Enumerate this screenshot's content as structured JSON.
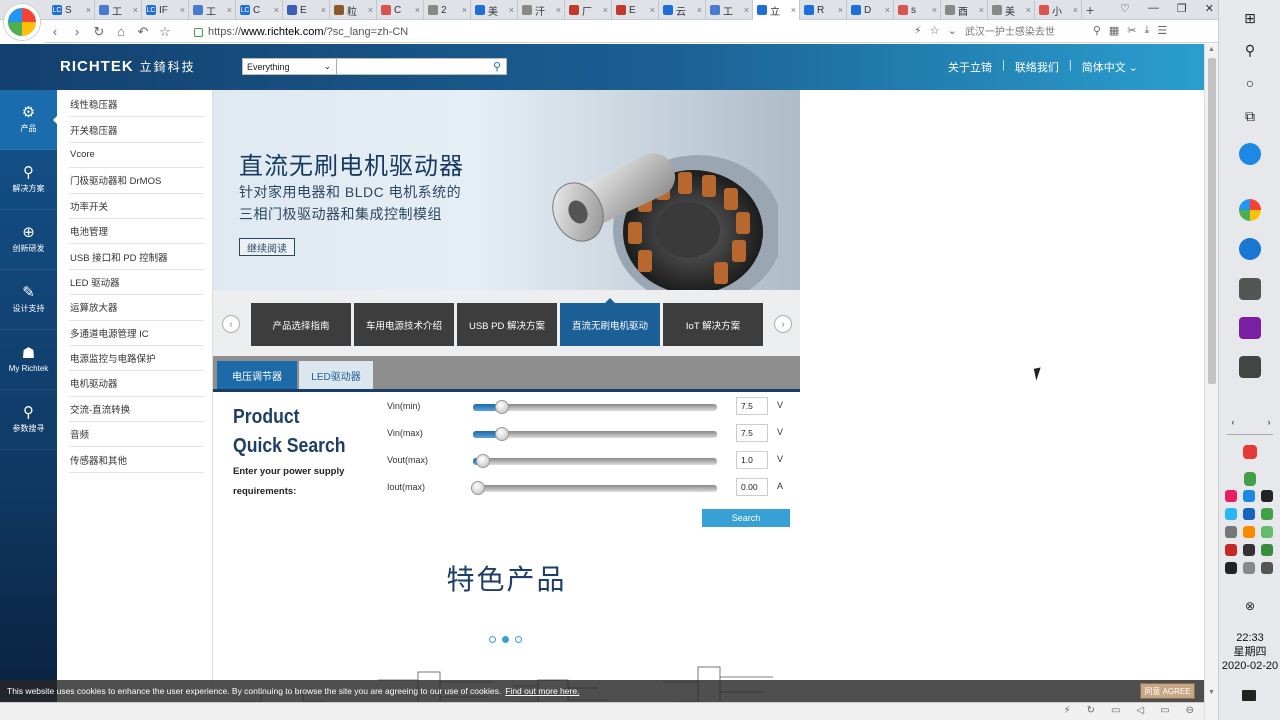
{
  "browser": {
    "tabs": [
      {
        "label": "S",
        "color": "#1e6fd9",
        "badge": "LC",
        "active": false
      },
      {
        "label": "工",
        "color": "#4a7bd0",
        "badge": "",
        "active": false
      },
      {
        "label": "IF",
        "color": "#1e6fd9",
        "badge": "LC",
        "active": false
      },
      {
        "label": "工",
        "color": "#4a7bd0",
        "badge": "",
        "active": false
      },
      {
        "label": "C",
        "color": "#1e6fd9",
        "badge": "LC",
        "active": false
      },
      {
        "label": "E",
        "color": "#3b5cb8",
        "badge": "",
        "active": false
      },
      {
        "label": "粒",
        "color": "#8a5a2b",
        "badge": "",
        "active": false
      },
      {
        "label": "C",
        "color": "#d9534f",
        "badge": "",
        "active": false
      },
      {
        "label": "2",
        "color": "#888888",
        "badge": "",
        "active": false
      },
      {
        "label": "美",
        "color": "#1e6fd9",
        "badge": "",
        "active": false
      },
      {
        "label": "汗",
        "color": "#888888",
        "badge": "",
        "active": false
      },
      {
        "label": "厂",
        "color": "#c0392b",
        "badge": "",
        "active": false
      },
      {
        "label": "E",
        "color": "#c0392b",
        "badge": "",
        "active": false
      },
      {
        "label": "云",
        "color": "#1e6fd9",
        "badge": "",
        "active": false
      },
      {
        "label": "工",
        "color": "#4a7bd0",
        "badge": "",
        "active": false
      },
      {
        "label": "立",
        "color": "#1e6fd9",
        "badge": "",
        "active": true
      },
      {
        "label": "R",
        "color": "#1e6fd9",
        "badge": "",
        "active": false
      },
      {
        "label": "D",
        "color": "#1e6fd9",
        "badge": "",
        "active": false
      },
      {
        "label": "s",
        "color": "#d9534f",
        "badge": "",
        "active": false
      },
      {
        "label": "酉",
        "color": "#888888",
        "badge": "",
        "active": false
      },
      {
        "label": "美",
        "color": "#888888",
        "badge": "",
        "active": false
      },
      {
        "label": "小",
        "color": "#d9534f",
        "badge": "",
        "active": false
      }
    ],
    "url_prefix": "https://",
    "url_domain": "www.richtek.com",
    "url_path": "/?sc_lang=zh-CN",
    "news_text": "武汉一护士感染去世"
  },
  "site": {
    "logo": "RICHTEK",
    "logo_cn": "立錡科技",
    "search_select": "Everything",
    "search_placeholder": "",
    "top_links": [
      "关于立锜",
      "联络我们",
      "简体中文"
    ]
  },
  "leftnav": [
    {
      "label": "产品",
      "icon": "chip-icon",
      "glyph": "⚙"
    },
    {
      "label": "解决方案",
      "icon": "solution-icon",
      "glyph": "⚲"
    },
    {
      "label": "创新研发",
      "icon": "innovation-icon",
      "glyph": "⊕"
    },
    {
      "label": "设计支持",
      "icon": "wrench-icon",
      "glyph": "✎"
    },
    {
      "label": "My Richtek",
      "icon": "user-icon",
      "glyph": "☗"
    },
    {
      "label": "参数搜寻",
      "icon": "search-icon",
      "glyph": "⚲"
    }
  ],
  "categories": [
    "线性稳压器",
    "开关稳压器",
    "Vcore",
    "门极驱动器和 DrMOS",
    "功率开关",
    "电池管理",
    "USB 接口和 PD 控制器",
    "LED 驱动器",
    "运算放大器",
    "多通道电源管理 IC",
    "电源监控与电路保护",
    "电机驱动器",
    "交流-直流转换",
    "音频",
    "传感器和其他"
  ],
  "hero": {
    "title": "直流无刷电机驱动器",
    "sub1": "针对家用电器和 BLDC 电机系统的",
    "sub2": "三相门极驱动器和集成控制模组",
    "button": "继续阅读"
  },
  "carousel": [
    "产品选择指南",
    "车用电源技术介绍",
    "USB PD 解决方案",
    "直流无刷电机驱动",
    "IoT 解决方案"
  ],
  "quick_search": {
    "tabs": [
      "电压调节器",
      "LED驱动器"
    ],
    "title1": "Product",
    "title2": "Quick Search",
    "desc1": "Enter your power supply",
    "desc2": "requirements:",
    "rows": [
      {
        "label": "Vin(min)",
        "value": "7.5",
        "unit": "V",
        "level": 0.1
      },
      {
        "label": "Vin(max)",
        "value": "7.5",
        "unit": "V",
        "level": 0.1
      },
      {
        "label": "Vout(max)",
        "value": "1.0",
        "unit": "V",
        "level": 0.02
      },
      {
        "label": "Iout(max)",
        "value": "0.00",
        "unit": "A",
        "level": 0.0
      }
    ],
    "search_btn": "Search"
  },
  "featured": {
    "title": "特色产品",
    "dots": 3,
    "active_dot": 1
  },
  "cookie": {
    "text": "This website uses cookies to enhance the user experience. By continuing to browse the site you are agreeing to our use of cookies.",
    "link": "Find out more here.",
    "button": "同意 AGREE"
  },
  "clock": {
    "time": "22:33",
    "day": "星期四",
    "date": "2020-02-20"
  },
  "colors": {
    "header_dark": "#13406e",
    "header_light": "#2a9fcf",
    "accent": "#1c6aa8"
  }
}
